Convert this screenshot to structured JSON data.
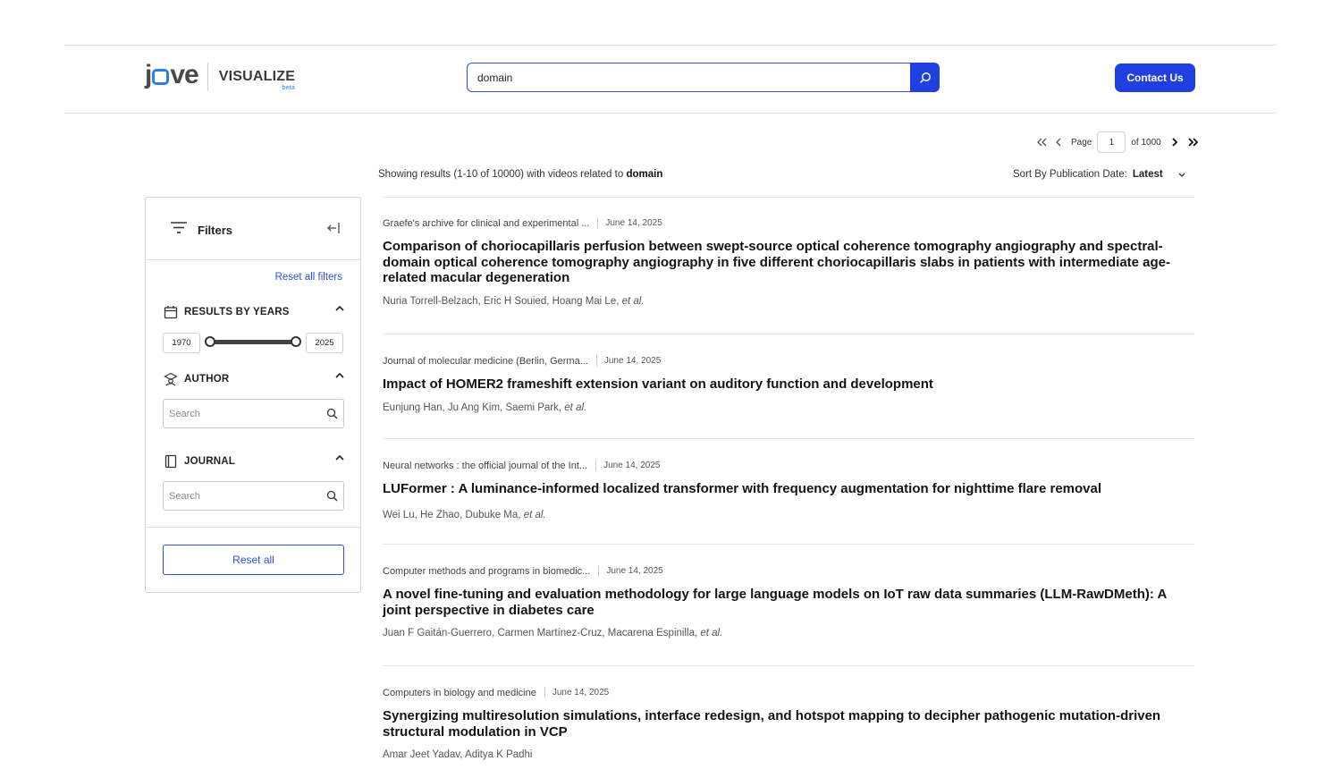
{
  "header": {
    "logo_text": "jove",
    "product": "VISUALIZE",
    "badge": "beta",
    "search_value": "domain",
    "contact_label": "Contact Us"
  },
  "pagination": {
    "page_label": "Page",
    "current_page": "1",
    "of_label": "of 1000"
  },
  "summary": {
    "prefix": "Showing results (1-10 of 10000) with videos related to",
    "query": "domain"
  },
  "sort": {
    "label": "Sort By Publication Date:",
    "value": "Latest"
  },
  "filters": {
    "title": "Filters",
    "reset_link": "Reset all filters",
    "years": {
      "title": "RESULTS BY YEARS",
      "min": "1970",
      "max": "2025"
    },
    "author": {
      "title": "AUTHOR",
      "placeholder": "Search"
    },
    "journal": {
      "title": "JOURNAL",
      "placeholder": "Search"
    },
    "reset_all": "Reset all"
  },
  "results": [
    {
      "journal": "Graefe's archive for clinical and experimental ...",
      "date": "June 14, 2025",
      "title": "Comparison of choriocapillaris perfusion between swept-source optical coherence tomography angiography and spectral-domain optical coherence tomography angiography in five different choriocapillaris slabs in patients with intermediate age-related macular degeneration",
      "authors": "Nuria Torrell-Belzach, Eric H Souied, Hoang Mai Le,",
      "etal": "et al."
    },
    {
      "journal": "Journal of molecular medicine (Berlin, Germa...",
      "date": "June 14, 2025",
      "title": "Impact of HOMER2 frameshift extension variant on auditory function and development",
      "authors": "Eunjung Han, Ju Ang Kim, Saemi Park,",
      "etal": "et al."
    },
    {
      "journal": "Neural networks : the official journal of the Int...",
      "date": "June 14, 2025",
      "title": "LUFormer : A luminance-informed localized transformer with frequency augmentation for nighttime flare removal",
      "authors": "Wei Lu, He Zhao, Dubuke Ma,",
      "etal": "et al."
    },
    {
      "journal": "Computer methods and programs in biomedic...",
      "date": "June 14, 2025",
      "title": "A novel fine-tuning and evaluation methodology for large language models on IoT raw data summaries (LLM-RawDMeth): A joint perspective in diabetes care",
      "authors": "Juan F Gaitán-Guerrero, Carmen Martínez-Cruz, Macarena Espinilla,",
      "etal": "et al."
    },
    {
      "journal": "Computers in biology and medicine",
      "date": "June 14, 2025",
      "title": "Synergizing multiresolution simulations, interface redesign, and hotspot mapping to decipher pathogenic mutation-driven structural modulation in VCP",
      "authors": "Amar Jeet Yadav, Aditya K Padhi",
      "etal": ""
    }
  ]
}
